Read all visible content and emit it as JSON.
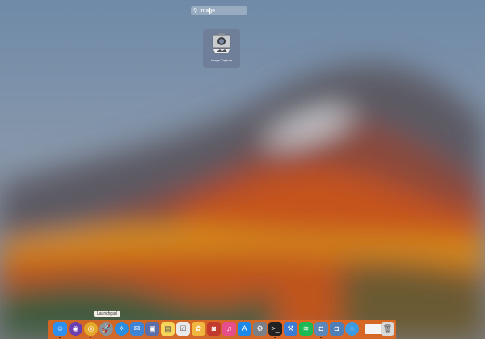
{
  "search": {
    "query": "image",
    "icon": "magnifier-icon"
  },
  "result": {
    "label": "Image Capture",
    "icon": "image-capture-icon"
  },
  "dock": {
    "tooltip": "Launchpad",
    "items": [
      {
        "name": "finder-icon",
        "glyph": "☺",
        "color": "#2d8ff0"
      },
      {
        "name": "siri-icon",
        "glyph": "◉",
        "color": "#6a3fb0"
      },
      {
        "name": "chrome-icon",
        "glyph": "◎",
        "color": "#e4a92a"
      },
      {
        "name": "launchpad-icon",
        "glyph": "🚀",
        "color": "#8a9198"
      },
      {
        "name": "safari-icon",
        "glyph": "✧",
        "color": "#2a8de0"
      },
      {
        "name": "mail-icon",
        "glyph": "✉",
        "color": "#3d83d6"
      },
      {
        "name": "preview-icon",
        "glyph": "▣",
        "color": "#5b6ea8"
      },
      {
        "name": "notes-icon",
        "glyph": "▤",
        "color": "#f6d55a"
      },
      {
        "name": "reminders-icon",
        "glyph": "☑",
        "color": "#e9e9e9"
      },
      {
        "name": "photos-icon",
        "glyph": "✿",
        "color": "#f2b740"
      },
      {
        "name": "photo-booth-icon",
        "glyph": "◙",
        "color": "#c23a2b"
      },
      {
        "name": "itunes-icon",
        "glyph": "♫",
        "color": "#e64e8b"
      },
      {
        "name": "app-store-icon",
        "glyph": "A",
        "color": "#1c88e8"
      },
      {
        "name": "system-preferences-icon",
        "glyph": "⚙",
        "color": "#7b7f86"
      },
      {
        "name": "terminal-icon",
        "glyph": ">_",
        "color": "#222222"
      },
      {
        "name": "xcode-icon",
        "glyph": "⚒",
        "color": "#3a7bd5"
      },
      {
        "name": "spotify-icon",
        "glyph": "≋",
        "color": "#1db954"
      },
      {
        "name": "image-capture-icon",
        "glyph": "◘",
        "color": "#5d87b8"
      },
      {
        "name": "screenshot-icon",
        "glyph": "◘",
        "color": "#4f7fb6"
      },
      {
        "name": "network-icon",
        "glyph": "◌",
        "color": "#3b9ae0"
      },
      {
        "name": "folder-icon",
        "glyph": "",
        "color": "#f4f4f4"
      },
      {
        "name": "trash-icon",
        "glyph": "🗑",
        "color": "#d8d8d8"
      }
    ]
  }
}
